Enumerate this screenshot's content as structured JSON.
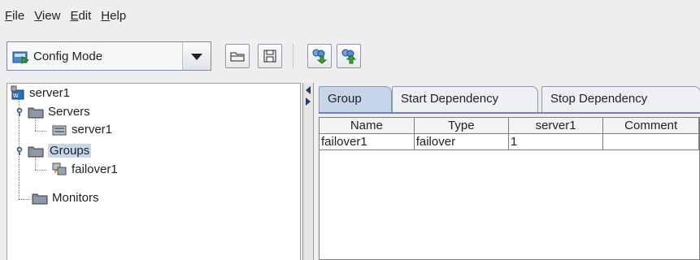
{
  "menu": {
    "file": {
      "mnemonic": "F",
      "rest": "ile"
    },
    "view": {
      "mnemonic": "V",
      "rest": "iew"
    },
    "edit": {
      "mnemonic": "E",
      "rest": "dit"
    },
    "help": {
      "mnemonic": "H",
      "rest": "elp"
    }
  },
  "toolbar": {
    "mode_selected": "Config Mode",
    "buttons": [
      "open-icon",
      "save-icon",
      "download-config-icon",
      "upload-config-icon"
    ]
  },
  "tree": {
    "root": "server1",
    "servers": "Servers",
    "server_item": "server1",
    "groups": "Groups",
    "group_item": "failover1",
    "monitors": "Monitors"
  },
  "tabs": [
    "Group",
    "Start Dependency",
    "Stop Dependency"
  ],
  "table": {
    "columns": [
      "Name",
      "Type",
      "server1",
      "Comment"
    ],
    "rows": [
      [
        "failover1",
        "failover",
        "1",
        ""
      ]
    ]
  },
  "colors": {
    "selection": "#c6d6ef",
    "active_tab": "#c6d5ea",
    "accent": "#1c3f6e"
  }
}
